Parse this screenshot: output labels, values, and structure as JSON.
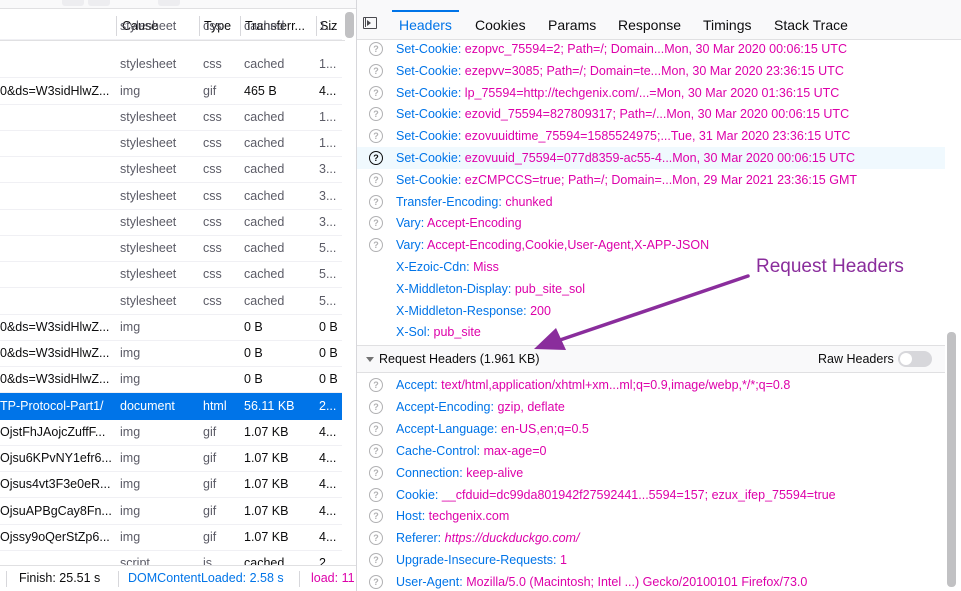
{
  "network_list": {
    "columns": [
      "Cause",
      "Type",
      "Transferr...",
      "Siz"
    ],
    "rows": [
      {
        "file": "",
        "cause": "stylesheet",
        "type": "css",
        "transferred": "cached",
        "size": "1..."
      },
      {
        "file": "",
        "cause": "stylesheet",
        "type": "css",
        "transferred": "cached",
        "size": "1..."
      },
      {
        "file": "0&ds=W3sidHlwZ...",
        "cause": "img",
        "type": "gif",
        "transferred": "465 B",
        "size": "4..."
      },
      {
        "file": "",
        "cause": "stylesheet",
        "type": "css",
        "transferred": "cached",
        "size": "1..."
      },
      {
        "file": "",
        "cause": "stylesheet",
        "type": "css",
        "transferred": "cached",
        "size": "1..."
      },
      {
        "file": "",
        "cause": "stylesheet",
        "type": "css",
        "transferred": "cached",
        "size": "3..."
      },
      {
        "file": "",
        "cause": "stylesheet",
        "type": "css",
        "transferred": "cached",
        "size": "3..."
      },
      {
        "file": "",
        "cause": "stylesheet",
        "type": "css",
        "transferred": "cached",
        "size": "3..."
      },
      {
        "file": "",
        "cause": "stylesheet",
        "type": "css",
        "transferred": "cached",
        "size": "5..."
      },
      {
        "file": "",
        "cause": "stylesheet",
        "type": "css",
        "transferred": "cached",
        "size": "5..."
      },
      {
        "file": "",
        "cause": "stylesheet",
        "type": "css",
        "transferred": "cached",
        "size": "5..."
      },
      {
        "file": "0&ds=W3sidHlwZ...",
        "cause": "img",
        "type": "",
        "transferred": "0 B",
        "size": "0 B"
      },
      {
        "file": "0&ds=W3sidHlwZ...",
        "cause": "img",
        "type": "",
        "transferred": "0 B",
        "size": "0 B"
      },
      {
        "file": "0&ds=W3sidHlwZ...",
        "cause": "img",
        "type": "",
        "transferred": "0 B",
        "size": "0 B"
      },
      {
        "file": "TP-Protocol-Part1/",
        "cause": "document",
        "type": "html",
        "transferred": "56.11 KB",
        "size": "2...",
        "selected": true
      },
      {
        "file": "OjstFhJAojcZuffF...",
        "cause": "img",
        "type": "gif",
        "transferred": "1.07 KB",
        "size": "4..."
      },
      {
        "file": "Ojsu6KPvNY1efr6...",
        "cause": "img",
        "type": "gif",
        "transferred": "1.07 KB",
        "size": "4..."
      },
      {
        "file": "Ojsus4vt3F3e0eR...",
        "cause": "img",
        "type": "gif",
        "transferred": "1.07 KB",
        "size": "4..."
      },
      {
        "file": "OjsuAPBgCay8Fn...",
        "cause": "img",
        "type": "gif",
        "transferred": "1.07 KB",
        "size": "4..."
      },
      {
        "file": "Ojssy9oQerStZp6...",
        "cause": "img",
        "type": "gif",
        "transferred": "1.07 KB",
        "size": "4..."
      },
      {
        "file": "",
        "cause": "script",
        "type": "js",
        "transferred": "cached",
        "size": "2..."
      }
    ],
    "status": {
      "finish": "Finish: 25.51 s",
      "dom_content_loaded": "DOMContentLoaded: 2.58 s",
      "load": "load: 11"
    }
  },
  "details": {
    "tabs": [
      "Headers",
      "Cookies",
      "Params",
      "Response",
      "Timings",
      "Stack Trace"
    ],
    "active_tab": "Headers",
    "response_headers": [
      {
        "name": "Set-Cookie:",
        "value": "ezopvc_75594=2; Path=/; Domain...Mon, 30 Mar 2020 00:06:15 UTC",
        "help": true
      },
      {
        "name": "Set-Cookie:",
        "value": "ezepvv=3085; Path=/; Domain=te...Mon, 30 Mar 2020 23:36:15 UTC",
        "help": true
      },
      {
        "name": "Set-Cookie:",
        "value": "lp_75594=http://techgenix.com/...=Mon, 30 Mar 2020 01:36:15 UTC",
        "help": true
      },
      {
        "name": "Set-Cookie:",
        "value": "ezovid_75594=827809317; Path=/...Mon, 30 Mar 2020 00:06:15 UTC",
        "help": true
      },
      {
        "name": "Set-Cookie:",
        "value": "ezovuuidtime_75594=1585524975;...Tue, 31 Mar 2020 23:36:15 UTC",
        "help": true
      },
      {
        "name": "Set-Cookie:",
        "value": "ezovuuid_75594=077d8359-ac55-4...Mon, 30 Mar 2020 00:06:15 UTC",
        "help": true,
        "highlighted": true
      },
      {
        "name": "Set-Cookie:",
        "value": "ezCMPCCS=true; Path=/; Domain=...Mon, 29 Mar 2021 23:36:15 GMT",
        "help": true
      },
      {
        "name": "Transfer-Encoding:",
        "value": "chunked",
        "help": true
      },
      {
        "name": "Vary:",
        "value": "Accept-Encoding",
        "help": true
      },
      {
        "name": "Vary:",
        "value": "Accept-Encoding,Cookie,User-Agent,X-APP-JSON",
        "help": true
      },
      {
        "name": "X-Ezoic-Cdn:",
        "value": "Miss",
        "help": false
      },
      {
        "name": "X-Middleton-Display:",
        "value": "pub_site_sol",
        "help": false
      },
      {
        "name": "X-Middleton-Response:",
        "value": "200",
        "help": false
      },
      {
        "name": "X-Sol:",
        "value": "pub_site",
        "help": false
      }
    ],
    "request_section": {
      "title": "Request Headers (1.961 KB)",
      "raw_label": "Raw Headers",
      "raw_enabled": false
    },
    "request_headers": [
      {
        "name": "Accept:",
        "value": "text/html,application/xhtml+xm...ml;q=0.9,image/webp,*/*;q=0.8"
      },
      {
        "name": "Accept-Encoding:",
        "value": "gzip, deflate"
      },
      {
        "name": "Accept-Language:",
        "value": "en-US,en;q=0.5"
      },
      {
        "name": "Cache-Control:",
        "value": "max-age=0"
      },
      {
        "name": "Connection:",
        "value": "keep-alive"
      },
      {
        "name": "Cookie:",
        "value": "__cfduid=dc99da801942f27592441...5594=157; ezux_ifep_75594=true"
      },
      {
        "name": "Host:",
        "value": "techgenix.com"
      },
      {
        "name": "Referer:",
        "value": "https://duckduckgo.com/",
        "italic": true
      },
      {
        "name": "Upgrade-Insecure-Requests:",
        "value": "1"
      },
      {
        "name": "User-Agent:",
        "value": "Mozilla/5.0 (Macintosh; Intel ...) Gecko/20100101 Firefox/73.0"
      }
    ]
  },
  "annotation": {
    "label": "Request Headers",
    "color": "#8a2d9c"
  },
  "colors": {
    "accent": "#0074e8",
    "header_value": "#dd00a9"
  }
}
